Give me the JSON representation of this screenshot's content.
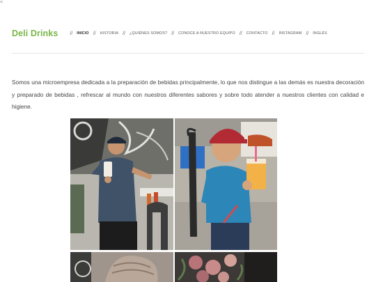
{
  "top_mark": "<",
  "brand": {
    "name": "Deli Drinks",
    "accent": "#7ab648"
  },
  "nav": {
    "separator": "//",
    "items": [
      {
        "label": "INICIO",
        "active": true
      },
      {
        "label": "HISTORIA",
        "active": false
      },
      {
        "label": "¿QUIÉNES SOMOS?",
        "active": false
      },
      {
        "label": "CONOCE A NUESTRO EQUIPO",
        "active": false
      },
      {
        "label": "CONTACTO",
        "active": false
      },
      {
        "label": "INSTAGRAM",
        "active": false
      },
      {
        "label": "INGLÉS",
        "active": false
      }
    ]
  },
  "main": {
    "intro": "Somos una microempresa dedicada a la preparación de bebidas principalmente, lo que nos distingue a las demás es nuestra decoración y preparado de bebidas , refrescar al mundo con nuestros diferentes sabores y sobre todo atender a nuestros clientes con calidad e higiene."
  },
  "gallery": [
    {
      "subject": "young man in cap holding a cup of drink"
    },
    {
      "subject": "smiling boy in red cap holding an orange drink"
    },
    {
      "subject": "person seen from behind"
    },
    {
      "subject": "flowers decoration"
    }
  ]
}
